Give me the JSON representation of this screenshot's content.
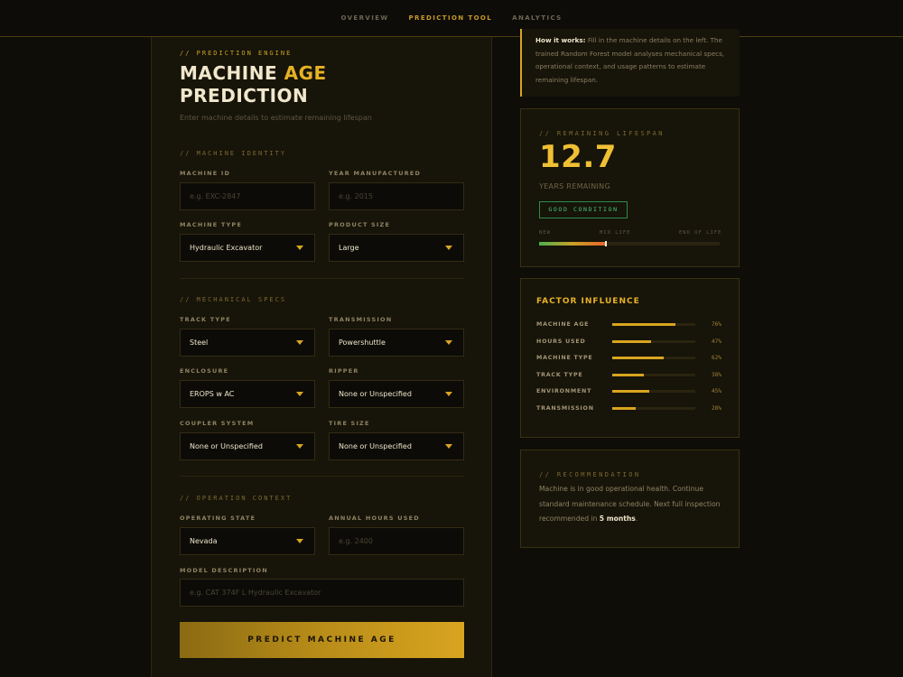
{
  "nav": {
    "items": [
      "OVERVIEW",
      "PREDICTION TOOL",
      "ANALYTICS"
    ],
    "active_index": 1
  },
  "form": {
    "eyebrow": "// PREDICTION ENGINE",
    "title_word1": "MACHINE",
    "title_word2": "AGE",
    "title_line2": "PREDICTION",
    "subtitle": "Enter machine details to estimate remaining lifespan",
    "sections": {
      "identity": "// MACHINE IDENTITY",
      "mechanical": "// MECHANICAL SPECS",
      "operation": "// OPERATION CONTEXT"
    },
    "machine_id": {
      "label": "MACHINE ID",
      "placeholder": "e.g. EXC-2847",
      "value": ""
    },
    "year_manufactured": {
      "label": "YEAR MANUFACTURED",
      "placeholder": "e.g. 2015",
      "value": ""
    },
    "machine_type": {
      "label": "MACHINE TYPE",
      "value": "Hydraulic Excavator"
    },
    "product_size": {
      "label": "PRODUCT SIZE",
      "value": "Large"
    },
    "track_type": {
      "label": "TRACK TYPE",
      "value": "Steel"
    },
    "transmission": {
      "label": "TRANSMISSION",
      "value": "Powershuttle"
    },
    "enclosure": {
      "label": "ENCLOSURE",
      "value": "EROPS w AC"
    },
    "ripper": {
      "label": "RIPPER",
      "value": "None or Unspecified"
    },
    "coupler_system": {
      "label": "COUPLER SYSTEM",
      "value": "None or Unspecified"
    },
    "tire_size": {
      "label": "TIRE SIZE",
      "value": "None or Unspecified"
    },
    "operating_state": {
      "label": "OPERATING STATE",
      "value": "Nevada"
    },
    "annual_hours": {
      "label": "ANNUAL HOURS USED",
      "placeholder": "e.g. 2400",
      "value": ""
    },
    "model_description": {
      "label": "MODEL DESCRIPTION",
      "placeholder": "e.g. CAT 374F L Hydraulic Excavator",
      "value": ""
    },
    "predict_button": "PREDICT MACHINE AGE"
  },
  "how_it_works": {
    "heading": "How it works:",
    "body": "Fill in the machine details on the left. The trained Random Forest model analyses mechanical specs, operational context, and usage patterns to estimate remaining lifespan."
  },
  "lifespan": {
    "eyebrow": "// REMAINING LIFESPAN",
    "value": "12.7",
    "unit_label": "YEARS REMAINING",
    "status_badge": "GOOD CONDITION",
    "scale_labels": [
      "NEW",
      "MID LIFE",
      "END OF LIFE"
    ],
    "life_used_fraction": 0.37
  },
  "factors": {
    "title": "FACTOR INFLUENCE",
    "items": [
      {
        "name": "MACHINE AGE",
        "percent": 76,
        "label": "76%"
      },
      {
        "name": "HOURS USED",
        "percent": 47,
        "label": "47%"
      },
      {
        "name": "MACHINE TYPE",
        "percent": 62,
        "label": "62%"
      },
      {
        "name": "TRACK TYPE",
        "percent": 38,
        "label": "38%"
      },
      {
        "name": "ENVIRONMENT",
        "percent": 45,
        "label": "45%"
      },
      {
        "name": "TRANSMISSION",
        "percent": 28,
        "label": "28%"
      }
    ]
  },
  "recommendation": {
    "eyebrow": "// RECOMMENDATION",
    "text_before": "Machine is in good operational health. Continue standard maintenance schedule. Next full inspection recommended in ",
    "emphasis": "5 months",
    "text_after": "."
  },
  "colors": {
    "accent": "#d9a520",
    "good": "#4bc77a",
    "background": "#0f0d07",
    "panel": "#171409"
  },
  "icons": {
    "dropdown_caret": "chevron-down-icon"
  }
}
